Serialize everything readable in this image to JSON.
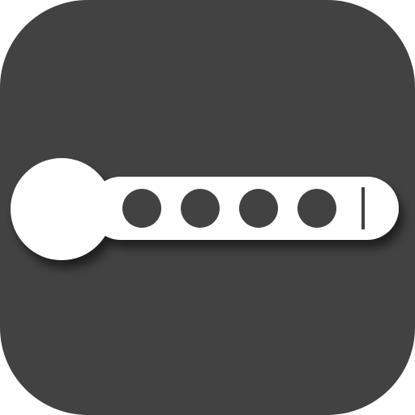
{
  "icon": {
    "name": "password-key-app-icon",
    "background_color": "#424242",
    "symbol_color": "#ffffff",
    "dot_color": "#424242",
    "masked_characters": 4,
    "shows_text_cursor": true
  }
}
